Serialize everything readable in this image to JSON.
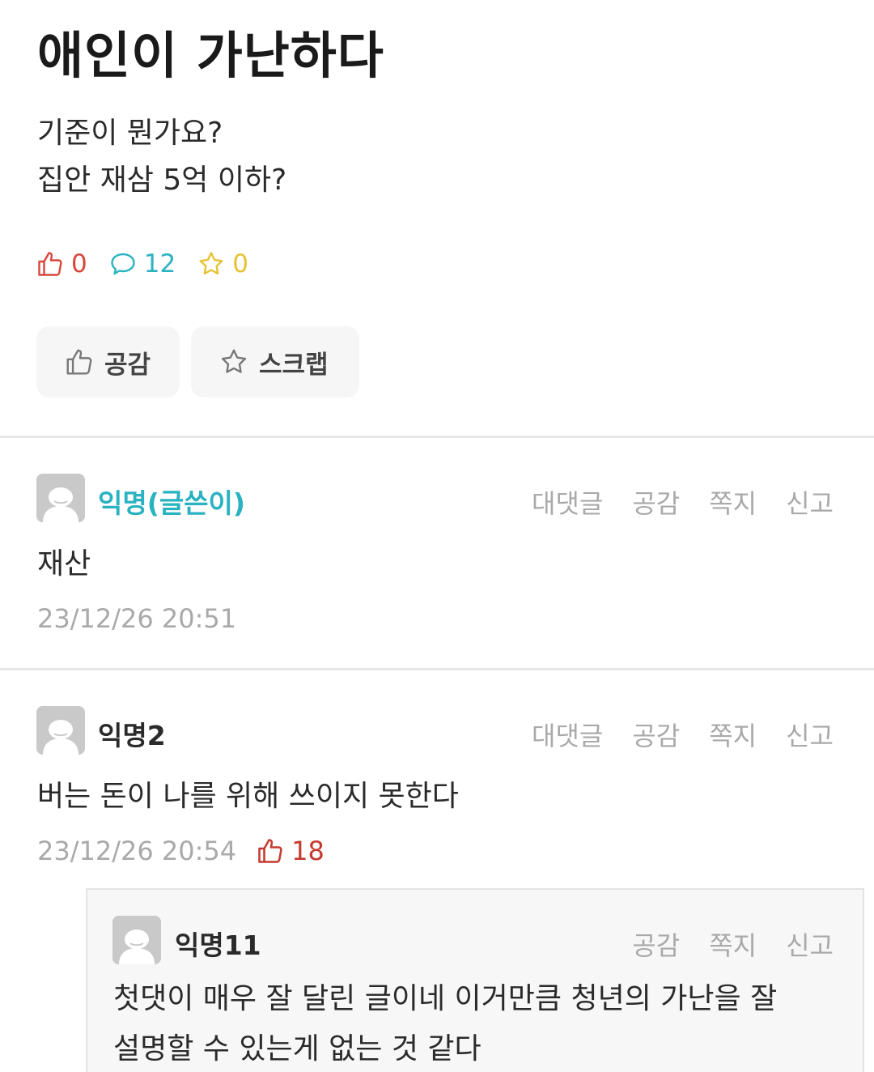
{
  "post": {
    "title": "애인이 가난하다",
    "body_lines": [
      "기준이 뭔가요?",
      "집안 재삼 5억 이하?"
    ],
    "stats": {
      "likes": "0",
      "comments": "12",
      "scraps": "0"
    },
    "actions": {
      "like_label": "공감",
      "scrap_label": "스크랩"
    }
  },
  "comments": [
    {
      "author": "익명(글쓴이)",
      "actions": [
        "대댓글",
        "공감",
        "쪽지",
        "신고"
      ],
      "text": "재산",
      "timestamp": "23/12/26 20:51"
    },
    {
      "author": "익명2",
      "actions": [
        "대댓글",
        "공감",
        "쪽지",
        "신고"
      ],
      "text": "버는 돈이 나를 위해 쓰이지 못한다",
      "timestamp": "23/12/26 20:54",
      "likes": "18"
    }
  ],
  "reply": {
    "author": "익명11",
    "actions": [
      "공감",
      "쪽지",
      "신고"
    ],
    "text_lines": [
      "첫댓이 매우 잘 달린 글이네 이거만큼 청년의 가난을 잘",
      "설명할 수 있는게 없는 것 같다"
    ]
  },
  "colors": {
    "op_author": "#29b2c0",
    "like_stat": "#d8463a",
    "comment_stat": "#2bb3c2",
    "scrap_stat": "#e6c233",
    "comment_like": "#c53a2f",
    "muted": "#a9a9a9"
  },
  "icons": {
    "like": "thumbs-up-icon",
    "comment": "speech-bubble-icon",
    "scrap": "star-icon",
    "avatar": "anonymous-user-icon"
  }
}
